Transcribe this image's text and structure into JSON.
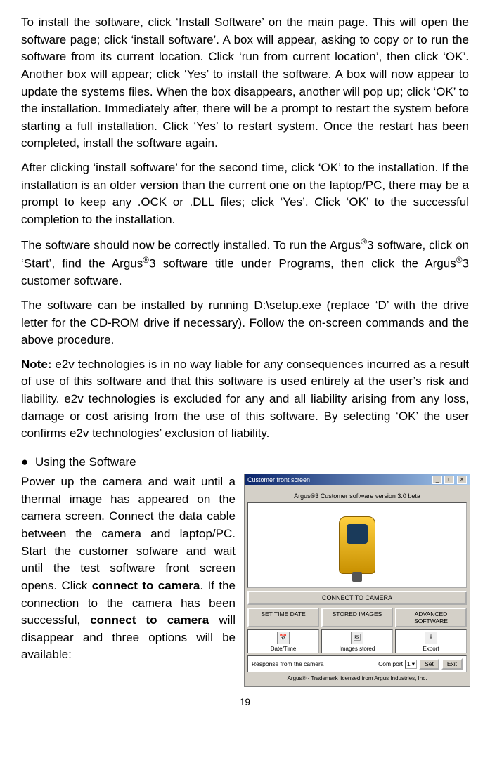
{
  "page_number": "19",
  "paragraphs": {
    "p1": "To install the software, click ‘Install Software’ on the main page. This will open the software page; click ‘install software’. A box will appear, asking to copy or to run the software from its current location. Click ‘run from current location’, then click ‘OK’. Another box will appear; click ‘Yes’ to install the software. A box will now appear to update the systems files. When the box disappears, another will pop up; click ‘OK’ to the installation. Immediately after, there will be a prompt to restart the system before starting a full installation. Click ‘Yes’ to restart system. Once the restart has been completed, install the software again.",
    "p2": "After clicking ‘install software’ for the second time, click ‘OK’ to the installation. If the installation is an older version than the current one on the laptop/PC, there may be a prompt to keep any .OCK or .DLL files; click ‘Yes’. Click ‘OK’ to the successful completion to the installation.",
    "p3_a": "The software should now be correctly installed. To run the Argus",
    "p3_b": "3 software, click on ‘Start’, find the Argus",
    "p3_c": "3 software title under Programs, then click the Argus",
    "p3_d": "3 customer software.",
    "p4": "The software can be installed by running D:\\setup.exe (replace ‘D’ with the drive letter for the CD-ROM drive if necessary). Follow the on-screen commands and the above procedure.",
    "note_label": "Note:",
    "p5": " e2v technologies is in no way liable for any consequences incurred as a result of use of this software and that this software is used entirely at the user’s risk and liability. e2v technologies is excluded for any and all liability arising from any loss, damage or cost arising from the use of this software. By selecting ‘OK’ the user confirms e2v technologies’ exclusion of liability.",
    "heading": "Using the Software",
    "p6_a": "Power up the camera and wait until a thermal image has appeared on the camera screen. Connect the data cable between the camera and laptop/PC. Start the customer sofware and wait until the test software front screen opens. Click ",
    "p6_bold1": "connect to camera",
    "p6_b": ". If the connection to the camera has been successful, ",
    "p6_bold2": "connect to camera",
    "p6_c": " will disappear and three options will be available:"
  },
  "reg": "®",
  "screenshot": {
    "window_title": "Customer front screen",
    "app_title": "Argus®3 Customer software version 3.0 beta",
    "connect_btn": "CONNECT TO CAMERA",
    "btn_set_time": "SET TIME DATE",
    "btn_stored": "STORED IMAGES",
    "btn_advanced": "ADVANCED SOFTWARE",
    "icon_date_label": "Date/Time",
    "icon_images_label": "Images stored",
    "icon_export_label": "Export",
    "response_label": "Response from the camera",
    "comport_label": "Com port",
    "comport_value": "1",
    "set_btn": "Set",
    "exit_btn": "Exit",
    "trademark": "Argus® - Trademark licensed from Argus Industries, Inc."
  }
}
